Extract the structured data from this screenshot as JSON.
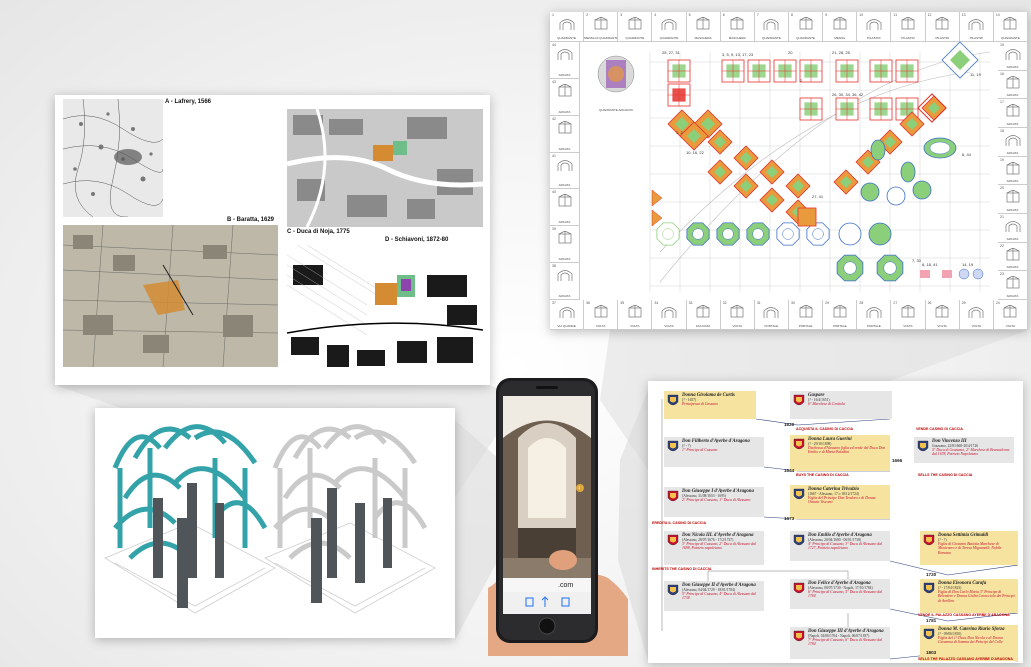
{
  "maps": [
    {
      "id": "A",
      "label": "A - Lafrery, 1566"
    },
    {
      "id": "B",
      "label": "B - Baratta, 1629"
    },
    {
      "id": "C",
      "label": "C - Duca di Noja, 1775"
    },
    {
      "id": "D",
      "label": "D - Schiavoni, 1872-80"
    }
  ],
  "sheet": {
    "top_numbers": [
      "1",
      "2",
      "3",
      "4",
      "5",
      "6",
      "7",
      "8",
      "9",
      "10",
      "11",
      "12",
      "13",
      "14"
    ],
    "top_captions": [
      "QUADRANTE",
      "MENSA DI QUADRANTE",
      "QUADRANTE",
      "QUADRANTE",
      "MASCHERA",
      "MASCHERA",
      "QUADRANTE",
      "QUADRANTE",
      "MENSA",
      "PILASTRI",
      "PILASTRI",
      "PILASTRI",
      "PILASTRI",
      "QUADRANTE"
    ],
    "bottom_numbers": [
      "37",
      "36",
      "35",
      "34",
      "33",
      "32",
      "31",
      "30",
      "29",
      "28",
      "27",
      "26",
      "25",
      "24"
    ],
    "bottom_captions": [
      "VIA QUADRE",
      "VOLTA",
      "VOLTA",
      "VOLTA",
      "FACCIATA",
      "VOLTA",
      "PORTALE",
      "PORTALE",
      "PORTALE",
      "PORTALE",
      "VOLTA",
      "VOLTA",
      "VOLTA",
      "VOLTA"
    ],
    "left_numbers": [
      "44",
      "43",
      "42",
      "41",
      "40",
      "39",
      "38"
    ],
    "left_captions": [
      "ARCATA",
      "ARCATA",
      "ARCATA",
      "ARCATA",
      "ARCATA",
      "ARCATA",
      "ARCATA"
    ],
    "right_numbers": [
      "15",
      "16",
      "17",
      "18",
      "19",
      "20",
      "21",
      "22",
      "23"
    ],
    "right_captions": [
      "ARCATA",
      "ARCATA",
      "ARCATA",
      "ARCATA",
      "ARCATA",
      "ARCATA",
      "ARCATA",
      "ARCATA",
      "ARCATA"
    ],
    "featured_caption": "QUADRANTE ARCHIVIO",
    "group_labels": [
      "25, 27, 31",
      "3, 5, 9, 13, 17, 23",
      "20",
      "21, 28, 25",
      "26, 30, 34, 36, 42",
      "11, 19",
      "1, 2",
      "10, 16, 22",
      "6, 44",
      "2",
      "27, 41",
      "7, 33",
      "8, 18, 41",
      "14, 19"
    ]
  },
  "genealogy": {
    "people": [
      {
        "name": "Donna Girolama de Curtis",
        "dates": "(? - 1657)",
        "title": "Principessa di Cassano"
      },
      {
        "name": "Gaspare",
        "dates": "(? - 16/4/1651)",
        "title": "6° Marchese di Grottola"
      },
      {
        "name": "Don Filiberto d'Ayerbe d'Aragona",
        "dates": "(? - ?)",
        "title": "1° Principe di Cassano"
      },
      {
        "name": "Donna Laura Guerini",
        "dates": "(? - 29/10/1698)",
        "title": "Duchessa d'Alessano figlia ed erede del Duca Don Emilio e di Maria Paladini"
      },
      {
        "name": "Don Vincenzo III",
        "dates": "Grazzano, 22/8/1660-20/4/1726",
        "title": "5° Duca di Grazzano, 2° Marchese di Brancaleone dal 1678, Patrizio Napoletano"
      },
      {
        "name": "Don Giuseppe I d'Ayerbe d'Aragona",
        "dates": "(Alessano, 31/08/1653 - 1695)",
        "title": "2° Principe di Cassano, 1° Duca di Alessano"
      },
      {
        "name": "Donna Caterina Trivulzio",
        "dates": "(1667 - Alessano, 17 o 18/12/1724)",
        "title": "Figlia del Principe Don Teodoro e di Donna Ottavia Visconti"
      },
      {
        "name": "Don Nicola III. d'Ayerbe d'Aragona",
        "dates": "(Alessano, 28/07/1676 - 17/2/1727)",
        "title": "3° Principe di Cassano, 2° Duca di Alessano dal 1698, Patrizio napoletano"
      },
      {
        "name": "Don Emilio d'Ayerbe d'Aragona",
        "dates": "(Alessano, 20/04/1680 - 06/01/1738)",
        "title": "4° Principe di Cassano, 3° Duca di Alessano dal 1727, Patrizio napoletano"
      },
      {
        "name": "Donna Settimia Grimaldi",
        "dates": "(? - ?)",
        "title": "Figlia di Giovanni Battista Marchese di Montenero e di Teresa Mignanelli, Nobile Romana"
      },
      {
        "name": "Don Giuseppe II d'Ayerbe d'Aragona",
        "dates": "(Alessano, 04/04/1729 - 18/01/1784)",
        "title": "5° Principe di Cassano, 4° Duca di Alessano dal 1738"
      },
      {
        "name": "Don Felice d'Ayerbe d'Aragona",
        "dates": "(Alessano, 08/07/1730 - Napoli, 17/10/1784)",
        "title": "6° Principe di Cassano, 5° Duca di Alessano dal 1784"
      },
      {
        "name": "Donna Eleonora Carafa",
        "dates": "(? - 17/04/1823)",
        "title": "Figlia di Don Carlo Maria 3° Principe di Belvedere e Donna Giulia Caracciolo dei Principi di Avellino"
      },
      {
        "name": "Don Giuseppe III d'Ayerbe d'Aragona",
        "dates": "(Napoli, 04/06/1764 - Napoli, 06/07/1837)",
        "title": "7° Principe di Cassano, 6° Duca di Alessano dal 1784"
      },
      {
        "name": "Donna M. Caterina Riario Sforza",
        "dates": "(? - 09/06/1810)",
        "title": "Figlia del 1° Duca Don Nicola e di Donna Giovanna di Somma dei Principi del Colle"
      }
    ],
    "years": [
      "1620",
      "1644",
      "1666",
      "1673",
      "1720",
      "1781",
      "1803"
    ],
    "events": [
      "ACQUISTA IL CASINO DI CACCIA",
      "VENDE CASINO DI CACCIA",
      "BUYS THE CASINO DI CACCIA",
      "SELLS THE CASINO DI CACCIA",
      "EREDITA IL CASINO DI CACCIA",
      "INHERITS THE CASINO DI CACCIA",
      "VENDE IL PALAZZO CASSANO AYERBE D'ARAGONA",
      "SELLS THE PALAZZO CASSANO AYERBE D'ARAGONA"
    ]
  },
  "phone": {
    "url_text": ".com",
    "ar_marker": "1"
  },
  "colors": {
    "teal": "#35b5b5",
    "red": "#e4322b",
    "orange": "#e89a3c",
    "green": "#8ccf7a",
    "blue": "#3a6fc9",
    "gold": "#f6e3a0",
    "navy": "#2a3e7a",
    "purple": "#8e44ad"
  }
}
